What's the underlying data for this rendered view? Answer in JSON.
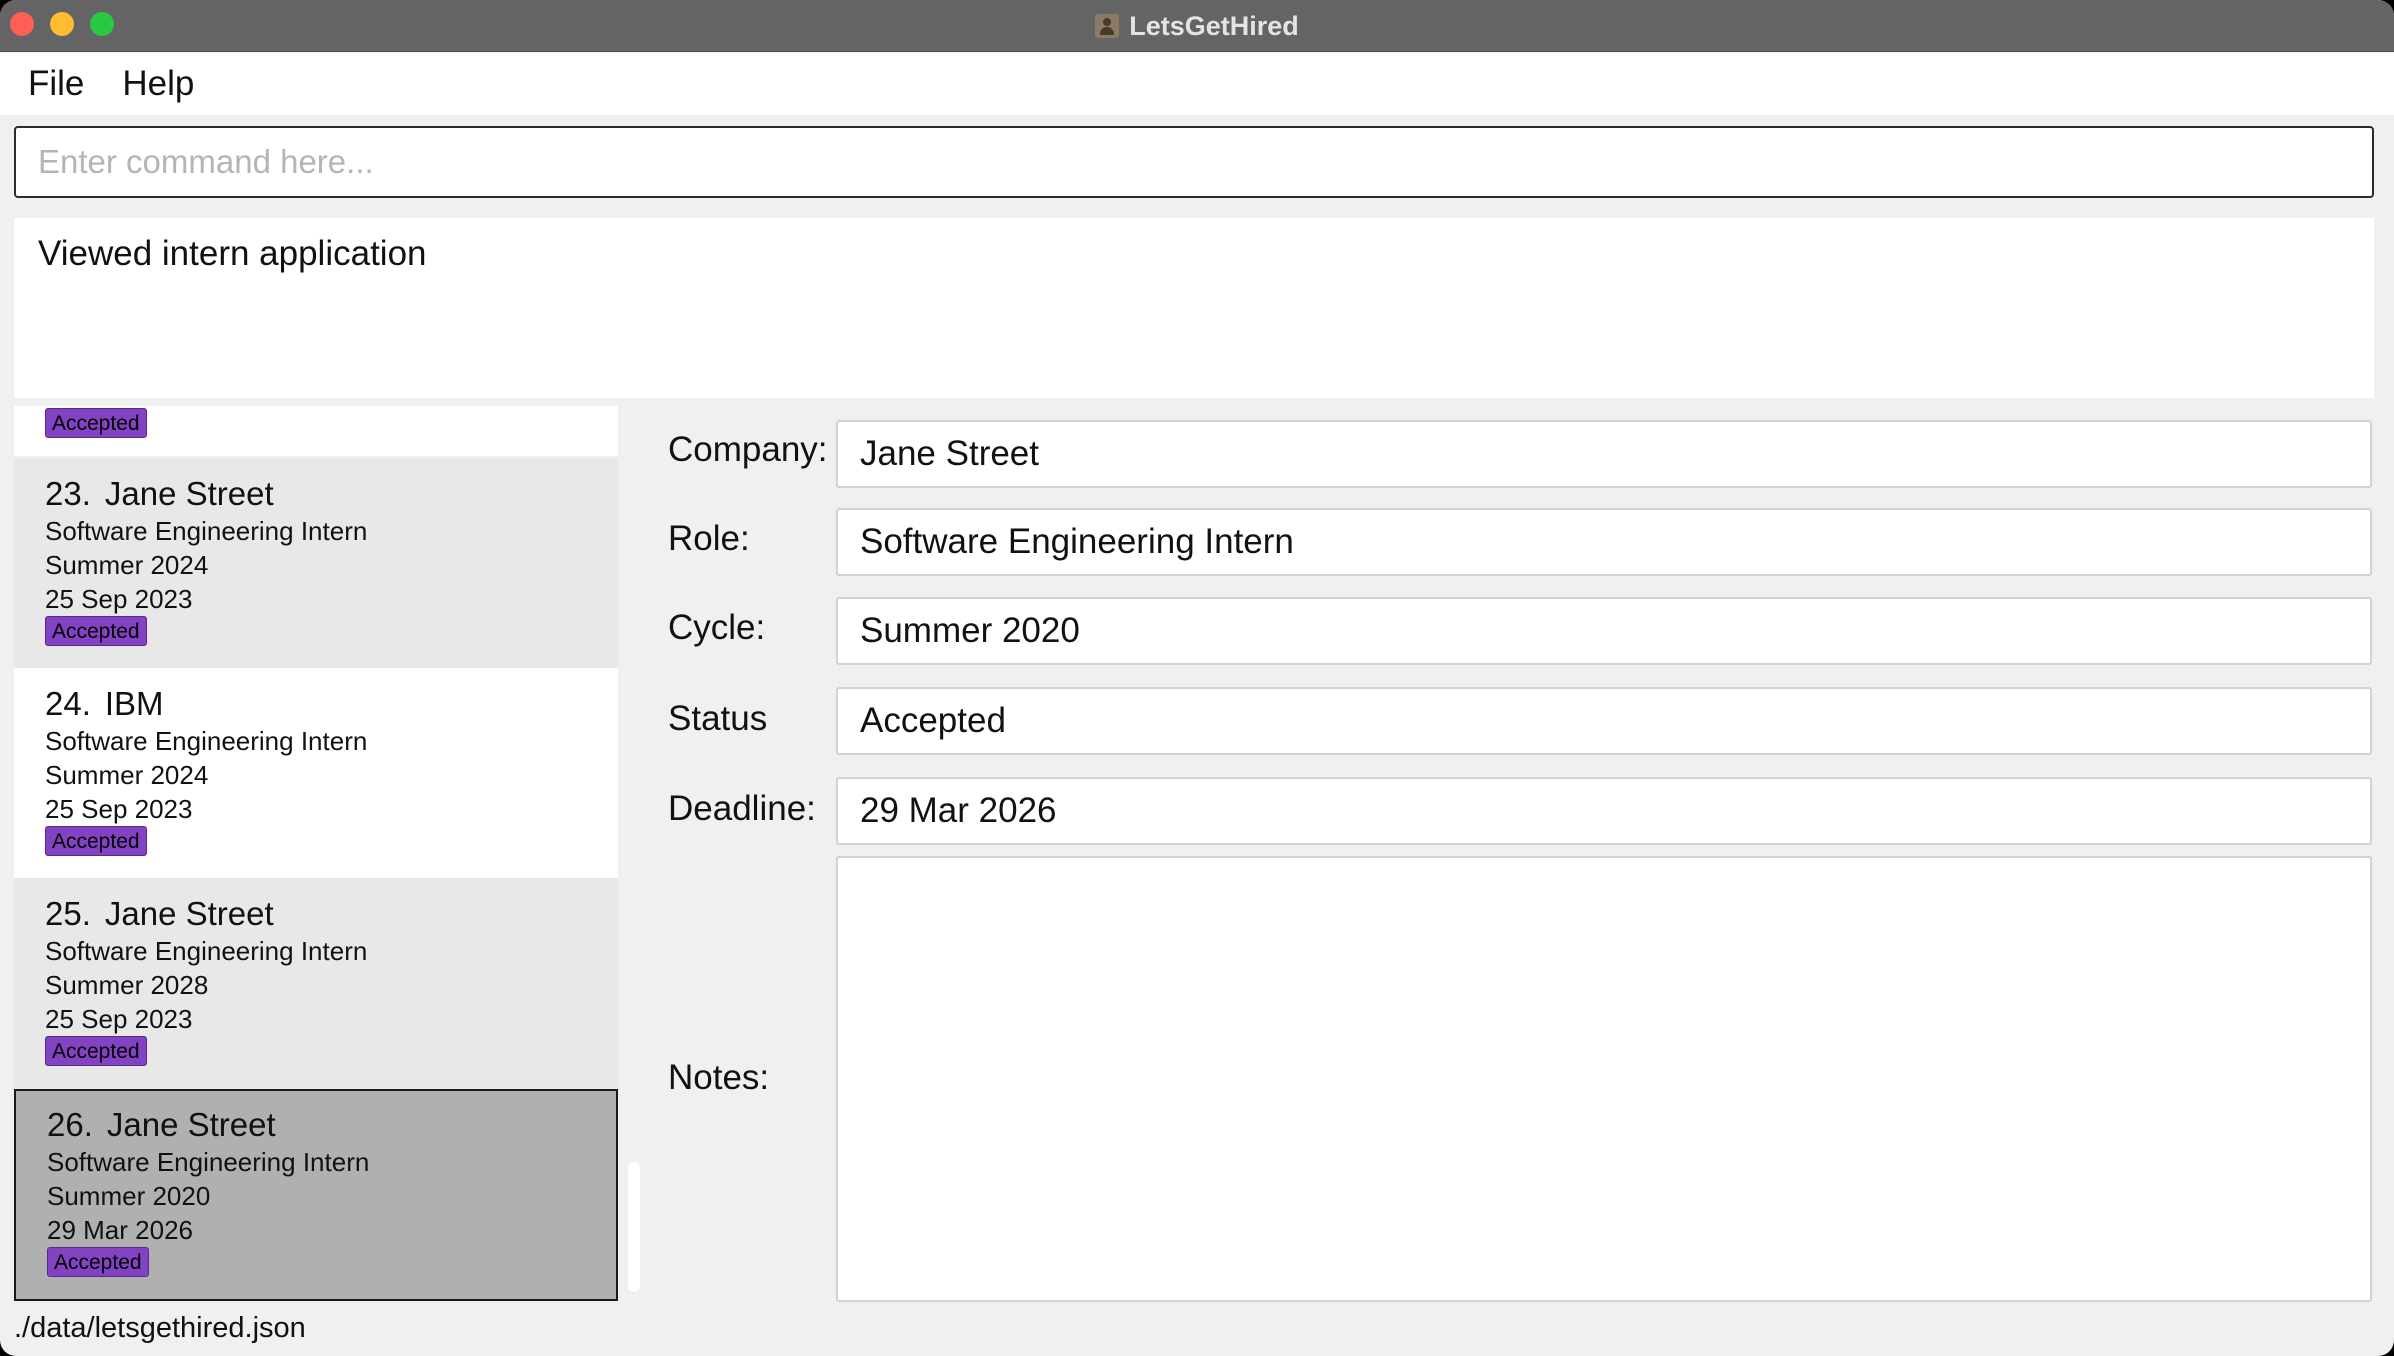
{
  "window": {
    "title": "LetsGetHired"
  },
  "menu": {
    "file": "File",
    "help": "Help"
  },
  "command": {
    "placeholder": "Enter command here...",
    "value": ""
  },
  "result": {
    "message": "Viewed intern application"
  },
  "list": {
    "top_partial_status": "Accepted",
    "items": [
      {
        "index": "23.",
        "company": "Jane Street",
        "role": "Software Engineering Intern",
        "cycle": "Summer 2024",
        "deadline": "25 Sep 2023",
        "status": "Accepted"
      },
      {
        "index": "24.",
        "company": "IBM",
        "role": "Software Engineering Intern",
        "cycle": "Summer 2024",
        "deadline": "25 Sep 2023",
        "status": "Accepted"
      },
      {
        "index": "25.",
        "company": "Jane Street",
        "role": "Software Engineering Intern",
        "cycle": "Summer 2028",
        "deadline": "25 Sep 2023",
        "status": "Accepted"
      },
      {
        "index": "26.",
        "company": "Jane Street",
        "role": "Software Engineering Intern",
        "cycle": "Summer 2020",
        "deadline": "29 Mar 2026",
        "status": "Accepted",
        "selected": true
      }
    ]
  },
  "detail": {
    "company_label": "Company:",
    "company": "Jane Street",
    "role_label": "Role:",
    "role": "Software Engineering Intern",
    "cycle_label": "Cycle:",
    "cycle": "Summer 2020",
    "status_label": "Status",
    "status": "Accepted",
    "deadline_label": "Deadline:",
    "deadline": "29 Mar 2026",
    "notes_label": "Notes:",
    "notes": ""
  },
  "status_bar": {
    "path": "./data/letsgethired.json"
  },
  "colors": {
    "tag": "#8342c2",
    "titlebar": "#646464",
    "selected": "#b0b0b0"
  }
}
